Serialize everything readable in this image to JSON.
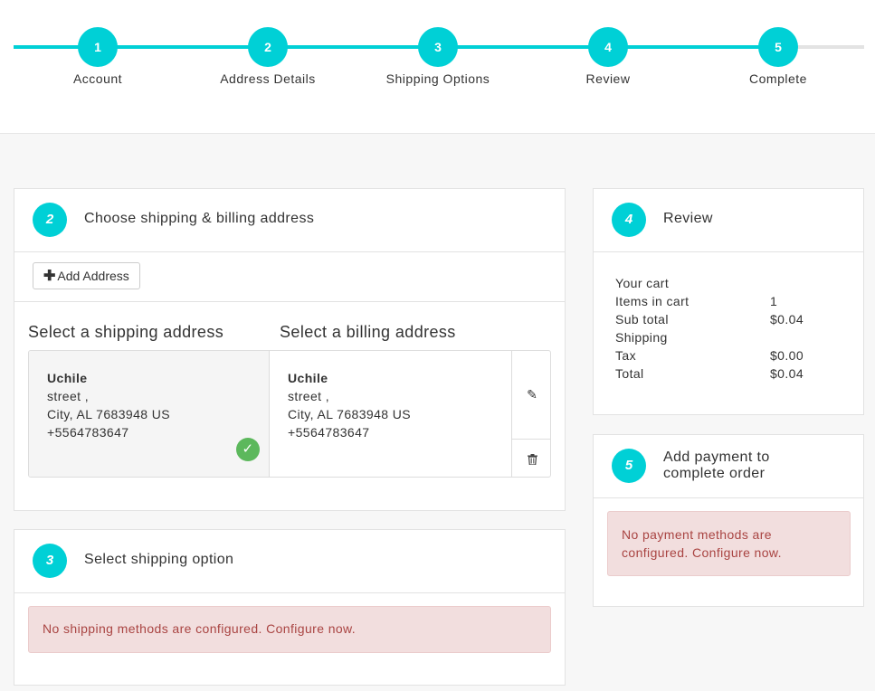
{
  "steps": [
    {
      "number": "1",
      "label": "Account"
    },
    {
      "number": "2",
      "label": "Address Details"
    },
    {
      "number": "3",
      "label": "Shipping Options"
    },
    {
      "number": "4",
      "label": "Review"
    },
    {
      "number": "5",
      "label": "Complete"
    }
  ],
  "address_panel": {
    "number": "2",
    "title": "Choose shipping & billing address",
    "add_button": "Add Address",
    "shipping_title": "Select a shipping address",
    "billing_title": "Select a billing address",
    "shipping_address": {
      "name": "Uchile",
      "street": "street ,",
      "city": "City, AL 7683948 US",
      "phone": "+5564783647"
    },
    "billing_address": {
      "name": "Uchile",
      "street": "street ,",
      "city": "City, AL 7683948 US",
      "phone": "+5564783647"
    }
  },
  "shipping_panel": {
    "number": "3",
    "title": "Select shipping option",
    "alert": "No shipping methods are configured. Configure now."
  },
  "review_panel": {
    "number": "4",
    "title": "Review",
    "cart_title": "Your cart",
    "rows": [
      {
        "label": "Items in cart",
        "value": "1"
      },
      {
        "label": "Sub total",
        "value": "$0.04"
      },
      {
        "label": "Shipping",
        "value": ""
      },
      {
        "label": "Tax",
        "value": "$0.00"
      },
      {
        "label": "Total",
        "value": "$0.04"
      }
    ]
  },
  "payment_panel": {
    "number": "5",
    "title_line1": "Add payment to",
    "title_line2": "complete order",
    "alert_line1": "No payment methods are",
    "alert_line2": "configured. Configure now."
  },
  "colors": {
    "accent": "#00d0d6",
    "success": "#5cb85c",
    "alert_bg": "#f2dede",
    "alert_text": "#a94442"
  }
}
